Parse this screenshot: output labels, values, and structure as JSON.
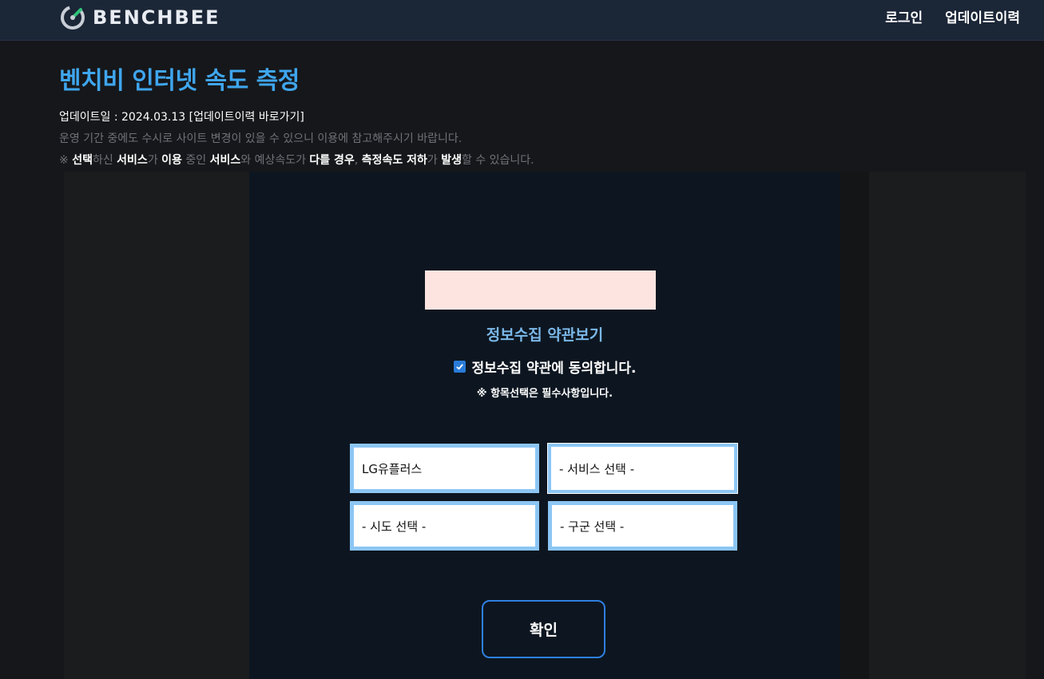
{
  "header": {
    "logo_text": "BENCHBEE",
    "nav": [
      "로그인",
      "업데이트이력"
    ]
  },
  "page": {
    "title": "벤치비 인터넷 속도 측정",
    "update_prefix": "업데이트일 : 2024.03.13 ",
    "update_link": "[업데이트이력 바로가기]",
    "notice": "운영 기간 중에도 수시로 사이트 변경이 있을 수 있으니 이용에 참고해주시기 바랍니다.",
    "warning_parts": [
      "※ ",
      "선택",
      "하신 ",
      "서비스",
      "가 ",
      "이용",
      " 중인 ",
      "서비스",
      "와 예상속도가 ",
      "다를 경우",
      ", ",
      "측정속도 저하",
      "가 ",
      "발생",
      "할 수 있습니다."
    ]
  },
  "form": {
    "terms_link": "정보수집 약관보기",
    "agree_checked": true,
    "agree_label": "정보수집 약관에 동의합니다.",
    "required_note": "※ 항목선택은 필수사항입니다.",
    "isp": "LG유플러스",
    "service": "- 서비스 선택 -",
    "sido": "- 시도 선택 -",
    "gugun": "- 구군 선택 -",
    "confirm": "확인"
  },
  "colors": {
    "accent": "#3fa6ee",
    "select_border": "#8cc6f4",
    "button_border": "#2f7fe0"
  }
}
